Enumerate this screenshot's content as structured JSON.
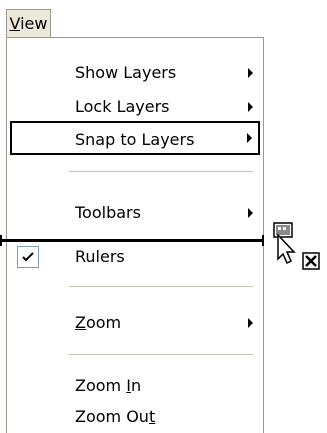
{
  "menubar": {
    "view_label": "View",
    "view_mnemonic": "V",
    "view_rest": "iew"
  },
  "menu": {
    "items": [
      {
        "label": "Show Layers",
        "has_submenu": true
      },
      {
        "label": "Lock Layers",
        "has_submenu": true
      },
      {
        "label": "Snap to Layers",
        "has_submenu": true,
        "highlighted": true
      },
      {
        "label": "Toolbars",
        "has_submenu": true
      },
      {
        "label": "Rulers",
        "checked": true
      },
      {
        "label_pre": "",
        "label_mnemonic": "Z",
        "label_post": "oom",
        "has_submenu": true
      },
      {
        "label_pre": "Zoom ",
        "label_mnemonic": "I",
        "label_post": "n"
      },
      {
        "label_pre": "Zoom Ou",
        "label_mnemonic": "t",
        "label_post": ""
      }
    ]
  },
  "icons": {
    "arrow": "submenu-arrow-icon",
    "check": "checkmark-icon",
    "cursor": "drag-cursor-icon"
  }
}
